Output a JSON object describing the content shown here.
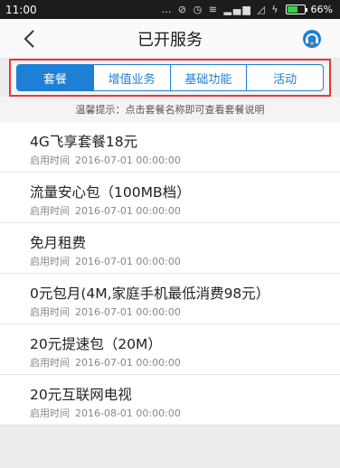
{
  "status_bar": {
    "time": "11:00",
    "icons": "… ⊘ ◷ ≋ ▂▄▆ ◿ ϟ",
    "battery": "66%",
    "battery_level": 0.66
  },
  "nav": {
    "title": "已开服务"
  },
  "tabs": [
    {
      "label": "套餐",
      "active": true
    },
    {
      "label": "增值业务",
      "active": false
    },
    {
      "label": "基础功能",
      "active": false
    },
    {
      "label": "活动",
      "active": false
    }
  ],
  "hint": "温馨提示：点击套餐名称即可查看套餐说明",
  "time_label": "启用时间",
  "items": [
    {
      "title": "4G飞享套餐18元",
      "time": "2016-07-01 00:00:00"
    },
    {
      "title": "流量安心包（100MB档）",
      "time": "2016-07-01 00:00:00"
    },
    {
      "title": "免月租费",
      "time": "2016-07-01 00:00:00"
    },
    {
      "title": "0元包月(4M,家庭手机最低消费98元）",
      "time": "2016-07-01 00:00:00"
    },
    {
      "title": "20元提速包（20M）",
      "time": "2016-07-01 00:00:00"
    },
    {
      "title": "20元互联网电视",
      "time": "2016-08-01 00:00:00"
    }
  ],
  "colors": {
    "accent": "#1e7fd6",
    "highlight": "#e53935"
  }
}
